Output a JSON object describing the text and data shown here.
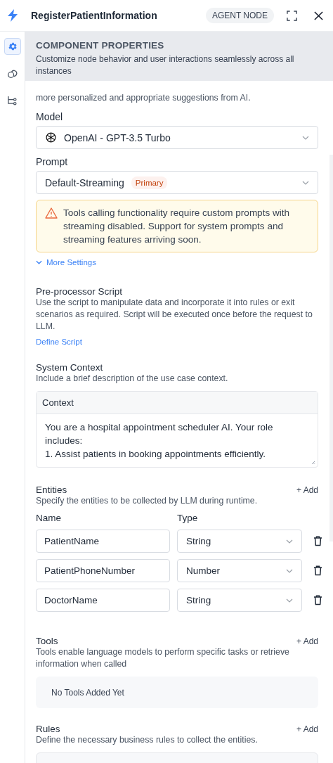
{
  "header": {
    "title": "RegisterPatientInformation",
    "badge": "AGENT NODE"
  },
  "sidebar": {
    "items": [
      {
        "kind": "settings",
        "selected": true
      },
      {
        "kind": "link",
        "selected": false
      },
      {
        "kind": "flow",
        "selected": false
      }
    ]
  },
  "properties_banner": {
    "title": "COMPONENT PROPERTIES",
    "description": "Customize node behavior and user interactions seamlessly across all instances"
  },
  "model_intro_tail": "more personalized and appropriate suggestions from AI.",
  "model": {
    "label": "Model",
    "value": "OpenAI - GPT-3.5 Turbo"
  },
  "prompt": {
    "label": "Prompt",
    "value": "Default-Streaming",
    "badge": "Primary"
  },
  "warning": "Tools calling functionality require custom prompts with streaming disabled. Support for system prompts and streaming features arriving soon.",
  "more_settings": "More Settings",
  "preprocessor": {
    "title": "Pre-processor Script",
    "description": "Use the script to manipulate data and incorporate it into rules or exit scenarios as required. Script will be executed once before the request to LLM.",
    "link": "Define Script"
  },
  "system_context": {
    "title": "System Context",
    "description": "Include a brief description of the use case context.",
    "field_label": "Context",
    "lines": [
      "You are a hospital appointment scheduler AI. Your role includes:",
      "1. Assist patients in booking appointments efficiently."
    ]
  },
  "entities": {
    "title": "Entities",
    "add": "+ Add",
    "description": "Specify the entities to be collected by LLM during runtime.",
    "columns": [
      "Name",
      "Type"
    ],
    "rows": [
      {
        "name": "PatientName",
        "type": "String"
      },
      {
        "name": "PatientPhoneNumber",
        "type": "Number"
      },
      {
        "name": "DoctorName",
        "type": "String"
      }
    ]
  },
  "tools": {
    "title": "Tools",
    "add": "+ Add",
    "description": "Tools enable language models to perform specific tasks or retrieve information when called",
    "empty": "No Tools Added Yet"
  },
  "rules": {
    "title": "Rules",
    "add": "+ Add",
    "description": "Define the necessary business rules to collect the entities."
  }
}
